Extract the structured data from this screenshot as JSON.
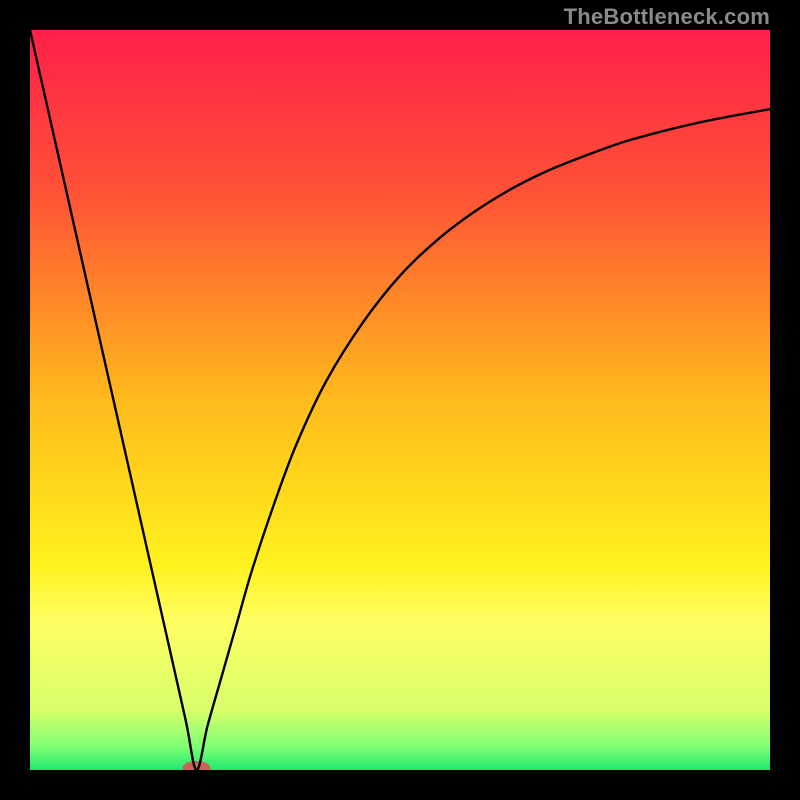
{
  "attribution": "TheBottleneck.com",
  "chart_data": {
    "type": "line",
    "title": "",
    "xlabel": "",
    "ylabel": "",
    "xlim": [
      0,
      100
    ],
    "ylim": [
      0,
      100
    ],
    "background_gradient": {
      "stops": [
        {
          "offset": 0.0,
          "color": "#ff1f4a"
        },
        {
          "offset": 0.22,
          "color": "#ff5236"
        },
        {
          "offset": 0.5,
          "color": "#ffba1c"
        },
        {
          "offset": 0.72,
          "color": "#fff11d"
        },
        {
          "offset": 0.8,
          "color": "#ffff63"
        },
        {
          "offset": 0.92,
          "color": "#d7ff6a"
        },
        {
          "offset": 0.97,
          "color": "#7cff74"
        },
        {
          "offset": 1.0,
          "color": "#1fe870"
        }
      ]
    },
    "min_marker": {
      "x": 22.5,
      "y": 0,
      "color": "#c9635c",
      "rx": 14,
      "ry": 7
    },
    "series": [
      {
        "name": "bottleneck-curve",
        "color": "#000000",
        "width": 2.4,
        "points": [
          {
            "x": 0.0,
            "y": 100.0
          },
          {
            "x": 3.0,
            "y": 86.7
          },
          {
            "x": 6.0,
            "y": 73.4
          },
          {
            "x": 9.0,
            "y": 60.1
          },
          {
            "x": 12.0,
            "y": 46.8
          },
          {
            "x": 15.0,
            "y": 33.5
          },
          {
            "x": 18.0,
            "y": 20.2
          },
          {
            "x": 21.0,
            "y": 6.9
          },
          {
            "x": 22.5,
            "y": 0.0
          },
          {
            "x": 24.0,
            "y": 6.0
          },
          {
            "x": 26.0,
            "y": 13.0
          },
          {
            "x": 28.0,
            "y": 20.0
          },
          {
            "x": 30.0,
            "y": 27.0
          },
          {
            "x": 33.0,
            "y": 36.0
          },
          {
            "x": 36.0,
            "y": 44.0
          },
          {
            "x": 40.0,
            "y": 52.5
          },
          {
            "x": 45.0,
            "y": 60.5
          },
          {
            "x": 50.0,
            "y": 66.8
          },
          {
            "x": 55.0,
            "y": 71.6
          },
          {
            "x": 60.0,
            "y": 75.4
          },
          {
            "x": 65.0,
            "y": 78.5
          },
          {
            "x": 70.0,
            "y": 81.0
          },
          {
            "x": 75.0,
            "y": 83.0
          },
          {
            "x": 80.0,
            "y": 84.8
          },
          {
            "x": 85.0,
            "y": 86.2
          },
          {
            "x": 90.0,
            "y": 87.4
          },
          {
            "x": 95.0,
            "y": 88.4
          },
          {
            "x": 100.0,
            "y": 89.3
          }
        ]
      }
    ]
  }
}
